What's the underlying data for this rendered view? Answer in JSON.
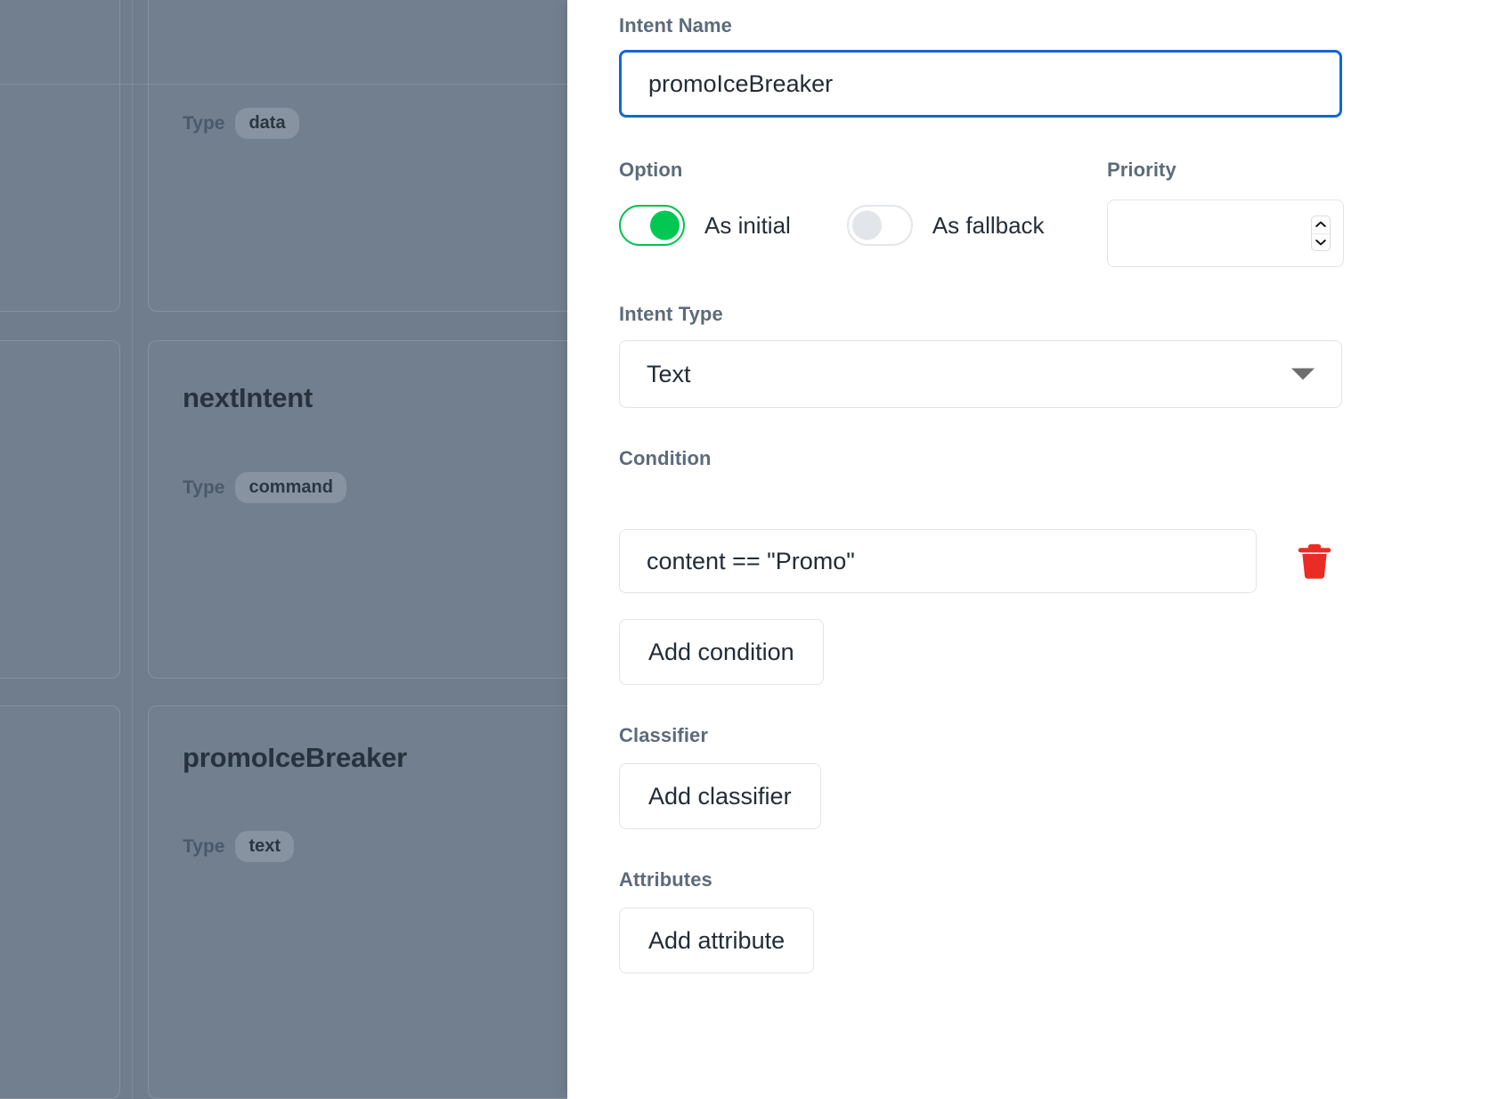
{
  "backdrop": {
    "cards": [
      {
        "title": "",
        "type_label": "Type",
        "type_value": "data"
      },
      {
        "title": "nextIntent",
        "type_label": "Type",
        "type_value": "command"
      },
      {
        "title": "promoIceBreaker",
        "type_label": "Type",
        "type_value": "text"
      }
    ]
  },
  "form": {
    "intent_name": {
      "label": "Intent Name",
      "value": "promoIceBreaker",
      "placeholder": ""
    },
    "option": {
      "label": "Option",
      "initial": {
        "label": "As initial",
        "state": "on"
      },
      "fallback": {
        "label": "As fallback",
        "state": "off"
      }
    },
    "priority": {
      "label": "Priority",
      "value": "",
      "placeholder": "",
      "spinner_up_icon": "chevron-up-icon",
      "spinner_down_icon": "chevron-down-icon"
    },
    "intent_type": {
      "label": "Intent Type",
      "selected": "Text",
      "caret_icon": "caret-down-icon"
    },
    "condition": {
      "label": "Condition",
      "rows": [
        {
          "value": "content == \"Promo\"",
          "delete_icon": "trash-icon"
        }
      ],
      "add_label": "Add condition"
    },
    "classifier": {
      "label": "Classifier",
      "add_label": "Add classifier"
    },
    "attributes": {
      "label": "Attributes",
      "add_label": "Add attribute"
    }
  },
  "colors": {
    "focus_border": "#1366d6",
    "toggle_on": "#00c853",
    "toggle_off": "#e2e5e9",
    "delete": "#ea2d24",
    "backdrop": "#6f7d8d"
  }
}
